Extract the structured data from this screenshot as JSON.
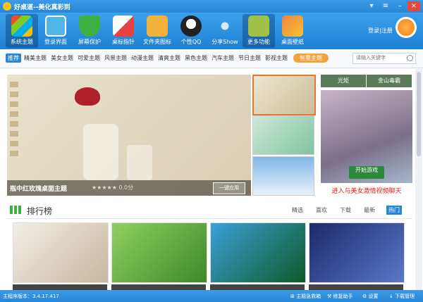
{
  "window": {
    "title": "好桌道--美化真彩到"
  },
  "toolbar": {
    "items": [
      {
        "label": "系统主题",
        "icon": "windows-logo-icon",
        "color": "#2a7fd4"
      },
      {
        "label": "登录界面",
        "icon": "monitor-icon",
        "color": "#52b6e8"
      },
      {
        "label": "屏幕保护",
        "icon": "shield-icon",
        "color": "#3cb043"
      },
      {
        "label": "桌标指针",
        "icon": "paper-plane-icon",
        "color": "#e64040"
      },
      {
        "label": "文件夹图标",
        "icon": "folder-icon",
        "color": "#f3b23b"
      },
      {
        "label": "个性QQ",
        "icon": "qq-penguin-icon",
        "color": "#222222"
      },
      {
        "label": "分享Show",
        "icon": "share-icon",
        "color": "#7fb3e8"
      },
      {
        "label": "更多功能",
        "icon": "gear-icon",
        "color": "#a0c048"
      },
      {
        "label": "桌面壁纸",
        "icon": "wallpaper-icon",
        "color": "#f0843a"
      }
    ],
    "login": "登录|注册"
  },
  "tabs": {
    "items": [
      "推荐",
      "精美主题",
      "美女主题",
      "可爱主题",
      "风景主题",
      "动漫主题",
      "清爽主题",
      "黑色主题",
      "汽车主题",
      "节日主题",
      "影视主题"
    ],
    "hot_button": "智夏主题",
    "search_placeholder": "请输入关键字"
  },
  "hero": {
    "title": "瓶中红玫瑰桌面主题",
    "stars": "★★★★★",
    "score": "0.0分",
    "apply_label": "一键应用"
  },
  "ad": {
    "tabs": [
      "光矩",
      "金山毒霸"
    ],
    "button": "开始游戏",
    "text": "进入与美女激情视频聊天"
  },
  "ranking": {
    "title": "排行榜",
    "sorts": [
      "精选",
      "喜欢",
      "下载",
      "最新",
      "热门"
    ]
  },
  "status": {
    "version": "主程序版本：3.4.17.417",
    "items": [
      "主题急救箱",
      "修复助手",
      "设置",
      "下载管理"
    ]
  }
}
